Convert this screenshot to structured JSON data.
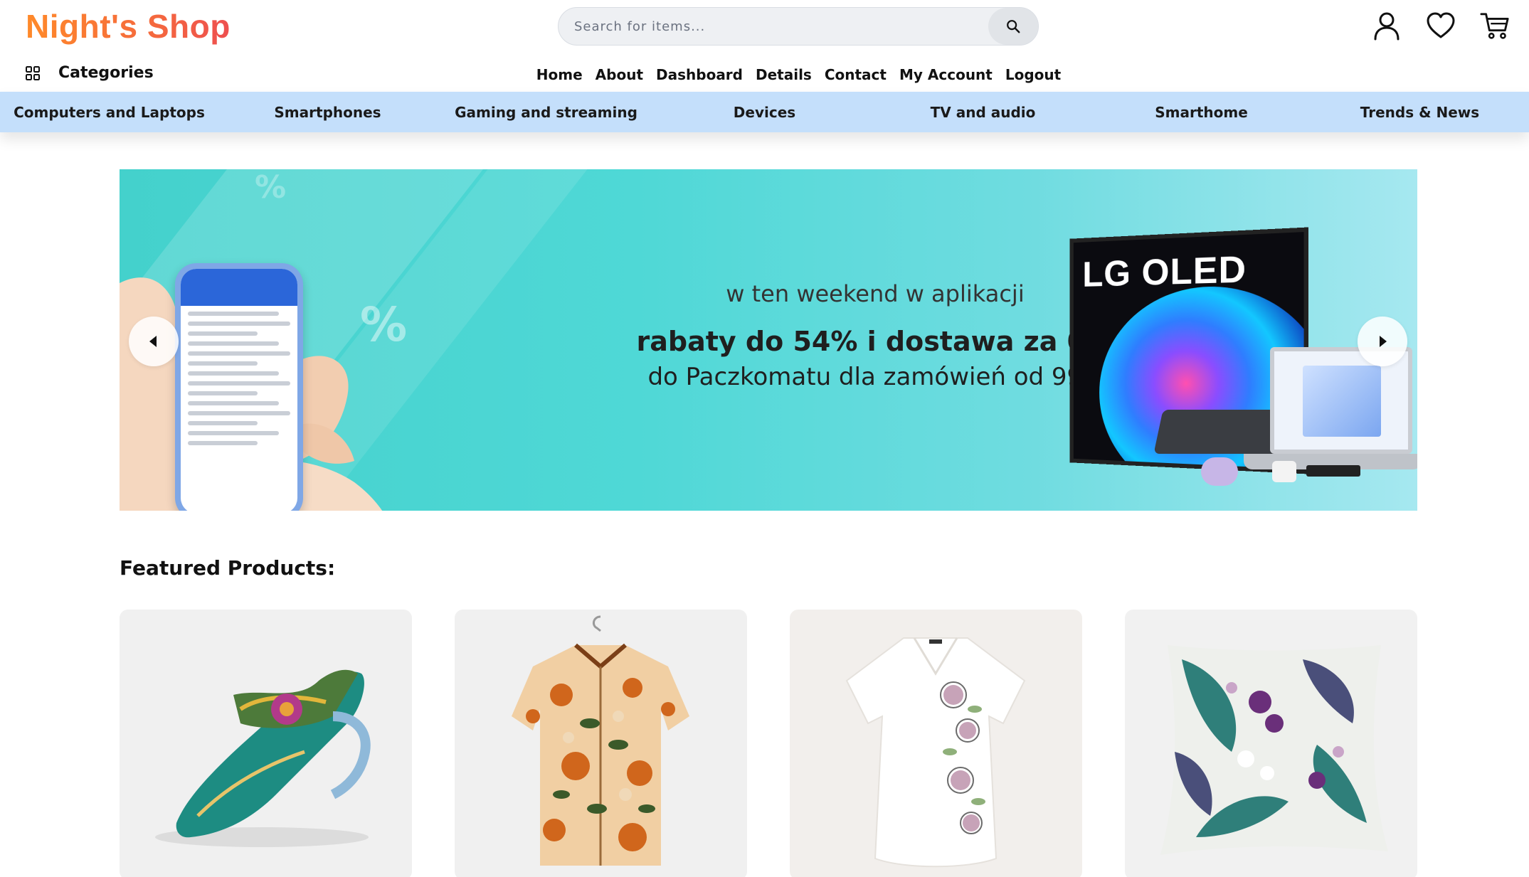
{
  "header": {
    "logo": "Night's Shop",
    "search_placeholder": "Search for items...",
    "icons": [
      "user-icon",
      "heart-icon",
      "cart-icon"
    ]
  },
  "categories_label": "Categories",
  "topnav": [
    "Home",
    "About",
    "Dashboard",
    "Details",
    "Contact",
    "My Account",
    "Logout"
  ],
  "category_bar": [
    "Computers and Laptops",
    "Smartphones",
    "Gaming and streaming",
    "Devices",
    "TV and audio",
    "Smarthome",
    "Trends & News"
  ],
  "banner": {
    "line1": "w ten weekend w aplikacji",
    "line2": "rabaty do 54% i dostawa za 0 zł",
    "line3": "do Paczkomatu dla zamówień od 99 zł",
    "tv_brand": "LG OLED",
    "percent_mark": "%"
  },
  "featured_title": "Featured Products:",
  "products": [
    "sandal",
    "floral-shirt",
    "white-floral-blouse",
    "tropical-pillow"
  ],
  "colors": {
    "logo_gradient": [
      "#ff8a2a",
      "#ee4f4f"
    ],
    "category_bar": "#c4dffb",
    "banner_bg": "#4fd8d6"
  }
}
